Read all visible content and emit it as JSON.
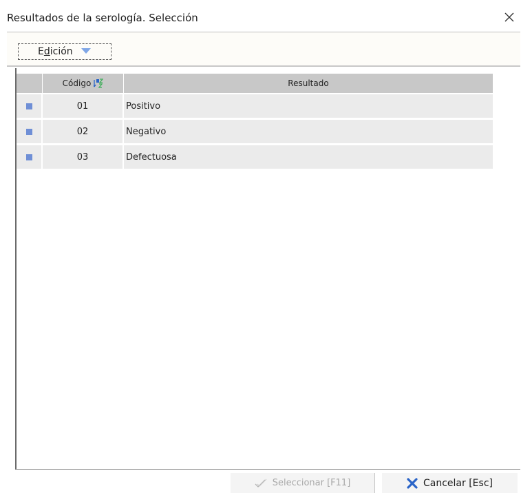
{
  "window": {
    "title": "Resultados de la serología. Selección"
  },
  "toolbar": {
    "edit_menu_label_prefix": "E",
    "edit_menu_label_underlined": "d",
    "edit_menu_label_rest": "ición"
  },
  "grid": {
    "columns": {
      "code": "Código",
      "result": "Resultado"
    },
    "rows": [
      {
        "code": "01",
        "result": "Positivo"
      },
      {
        "code": "02",
        "result": "Negativo"
      },
      {
        "code": "03",
        "result": "Defectuosa"
      }
    ]
  },
  "footer": {
    "select_label": "Seleccionar [F11]",
    "select_enabled": false,
    "cancel_label": "Cancelar [Esc]"
  },
  "icons": {
    "close": "close-icon",
    "edit_dropdown": "chevron-down-icon",
    "sort": "sort-az-icon",
    "select": "check-icon",
    "cancel": "x-mark-icon",
    "row_marker": "row-marker-icon"
  },
  "colors": {
    "row_background": "#ebebeb",
    "header_background": "#c8c8c8",
    "row_marker": "#6f8fd6",
    "cancel_icon": "#2a64c8",
    "dropdown_arrow": "#7fa6e6"
  }
}
